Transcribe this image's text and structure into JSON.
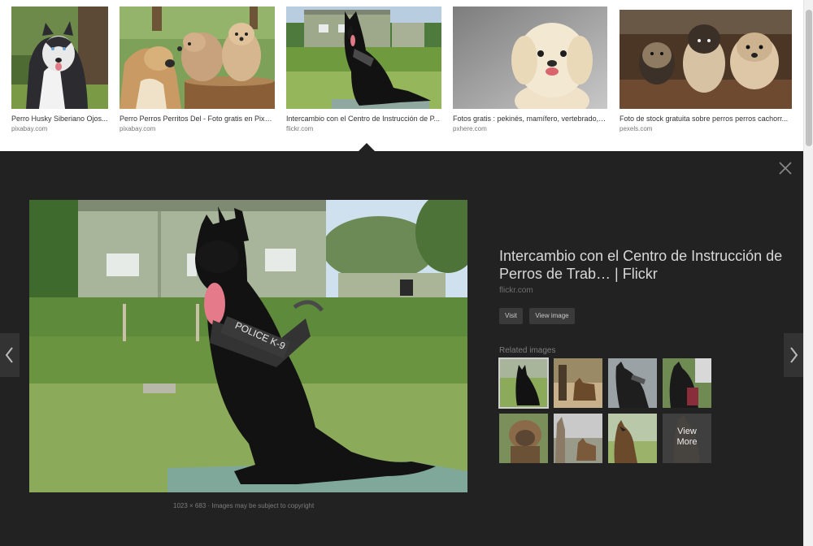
{
  "results": [
    {
      "title": "Perro Husky Siberiano Ojos...",
      "source": "pixabay.com",
      "thumb_icon": "husky-photo"
    },
    {
      "title": "Perro Perros Perritos Del - Foto gratis en Pixa...",
      "source": "pixabay.com",
      "thumb_icon": "puppies-photo"
    },
    {
      "title": "Intercambio con el Centro de Instrucción de P...",
      "source": "flickr.com",
      "thumb_icon": "police-dog-photo"
    },
    {
      "title": "Fotos gratis : pekinés, mamífero, vertebrado, r...",
      "source": "pxhere.com",
      "thumb_icon": "pekingese-photo"
    },
    {
      "title": "Foto de stock gratuita sobre perros perros cachorr...",
      "source": "pexels.com",
      "thumb_icon": "terriers-photo"
    }
  ],
  "preview": {
    "title": "Intercambio con el Centro de Instrucción de Perros de Trab… | Flickr",
    "domain": "flickr.com",
    "visit_label": "Visit",
    "view_image_label": "View image",
    "related_label": "Related images",
    "caption_size": "1023 × 683",
    "caption_note": "Images may be subject to copyright",
    "vest_text": "POLICE K-9",
    "view_more_line1": "View",
    "view_more_line2": "More"
  },
  "icons": {
    "close": "close-icon",
    "prev": "chevron-left-icon",
    "next": "chevron-right-icon"
  },
  "colors": {
    "panel_bg": "#222222",
    "button_bg": "#3a3a3a",
    "headline": "#d8d8d8",
    "muted": "#7d7d7d"
  }
}
